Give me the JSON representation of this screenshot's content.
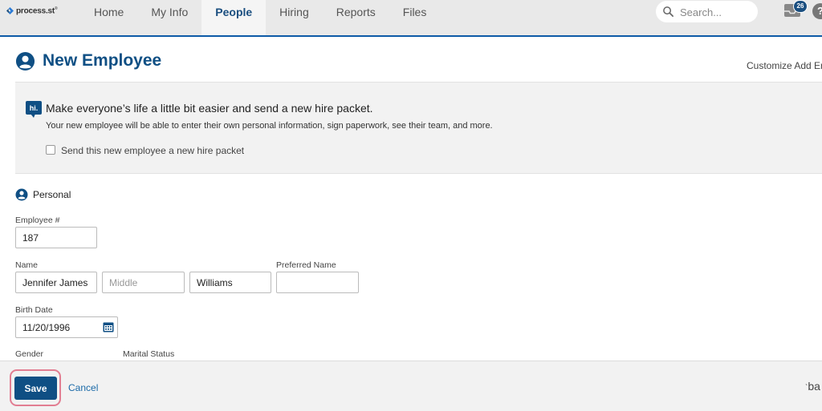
{
  "brand": {
    "logo_text": "process.st",
    "logo_tm": "®"
  },
  "nav": {
    "items": [
      {
        "label": "Home",
        "active": false
      },
      {
        "label": "My Info",
        "active": false
      },
      {
        "label": "People",
        "active": true
      },
      {
        "label": "Hiring",
        "active": false
      },
      {
        "label": "Reports",
        "active": false
      },
      {
        "label": "Files",
        "active": false
      }
    ],
    "search_placeholder": "Search...",
    "inbox_count": "26",
    "help_label": "?"
  },
  "page": {
    "title": "New Employee",
    "customize_link": "Customize Add Em"
  },
  "hire_packet": {
    "icon_text": "hi.",
    "title": "Make everyone’s life a little bit easier and send a new hire packet.",
    "description": "Your new employee will be able to enter their own personal information, sign paperwork, see their team, and more.",
    "checkbox_label": "Send this new employee a new hire packet",
    "checked": false
  },
  "personal": {
    "section_title": "Personal",
    "employee_number": {
      "label": "Employee #",
      "value": "187"
    },
    "name": {
      "label": "Name",
      "first": "Jennifer James",
      "middle_placeholder": "Middle",
      "last": "Williams"
    },
    "preferred_name": {
      "label": "Preferred Name",
      "value": ""
    },
    "birth_date": {
      "label": "Birth Date",
      "value": "11/20/1996"
    },
    "gender_label": "Gender",
    "marital_status_label": "Marital Status"
  },
  "footer": {
    "save_label": "Save",
    "cancel_label": "Cancel",
    "brand_fragment": "ba"
  },
  "colors": {
    "primary": "#0f4f84",
    "link": "#1b6aa8",
    "highlight_ring": "#e27e92",
    "nav_underline": "#0d5aa7"
  }
}
